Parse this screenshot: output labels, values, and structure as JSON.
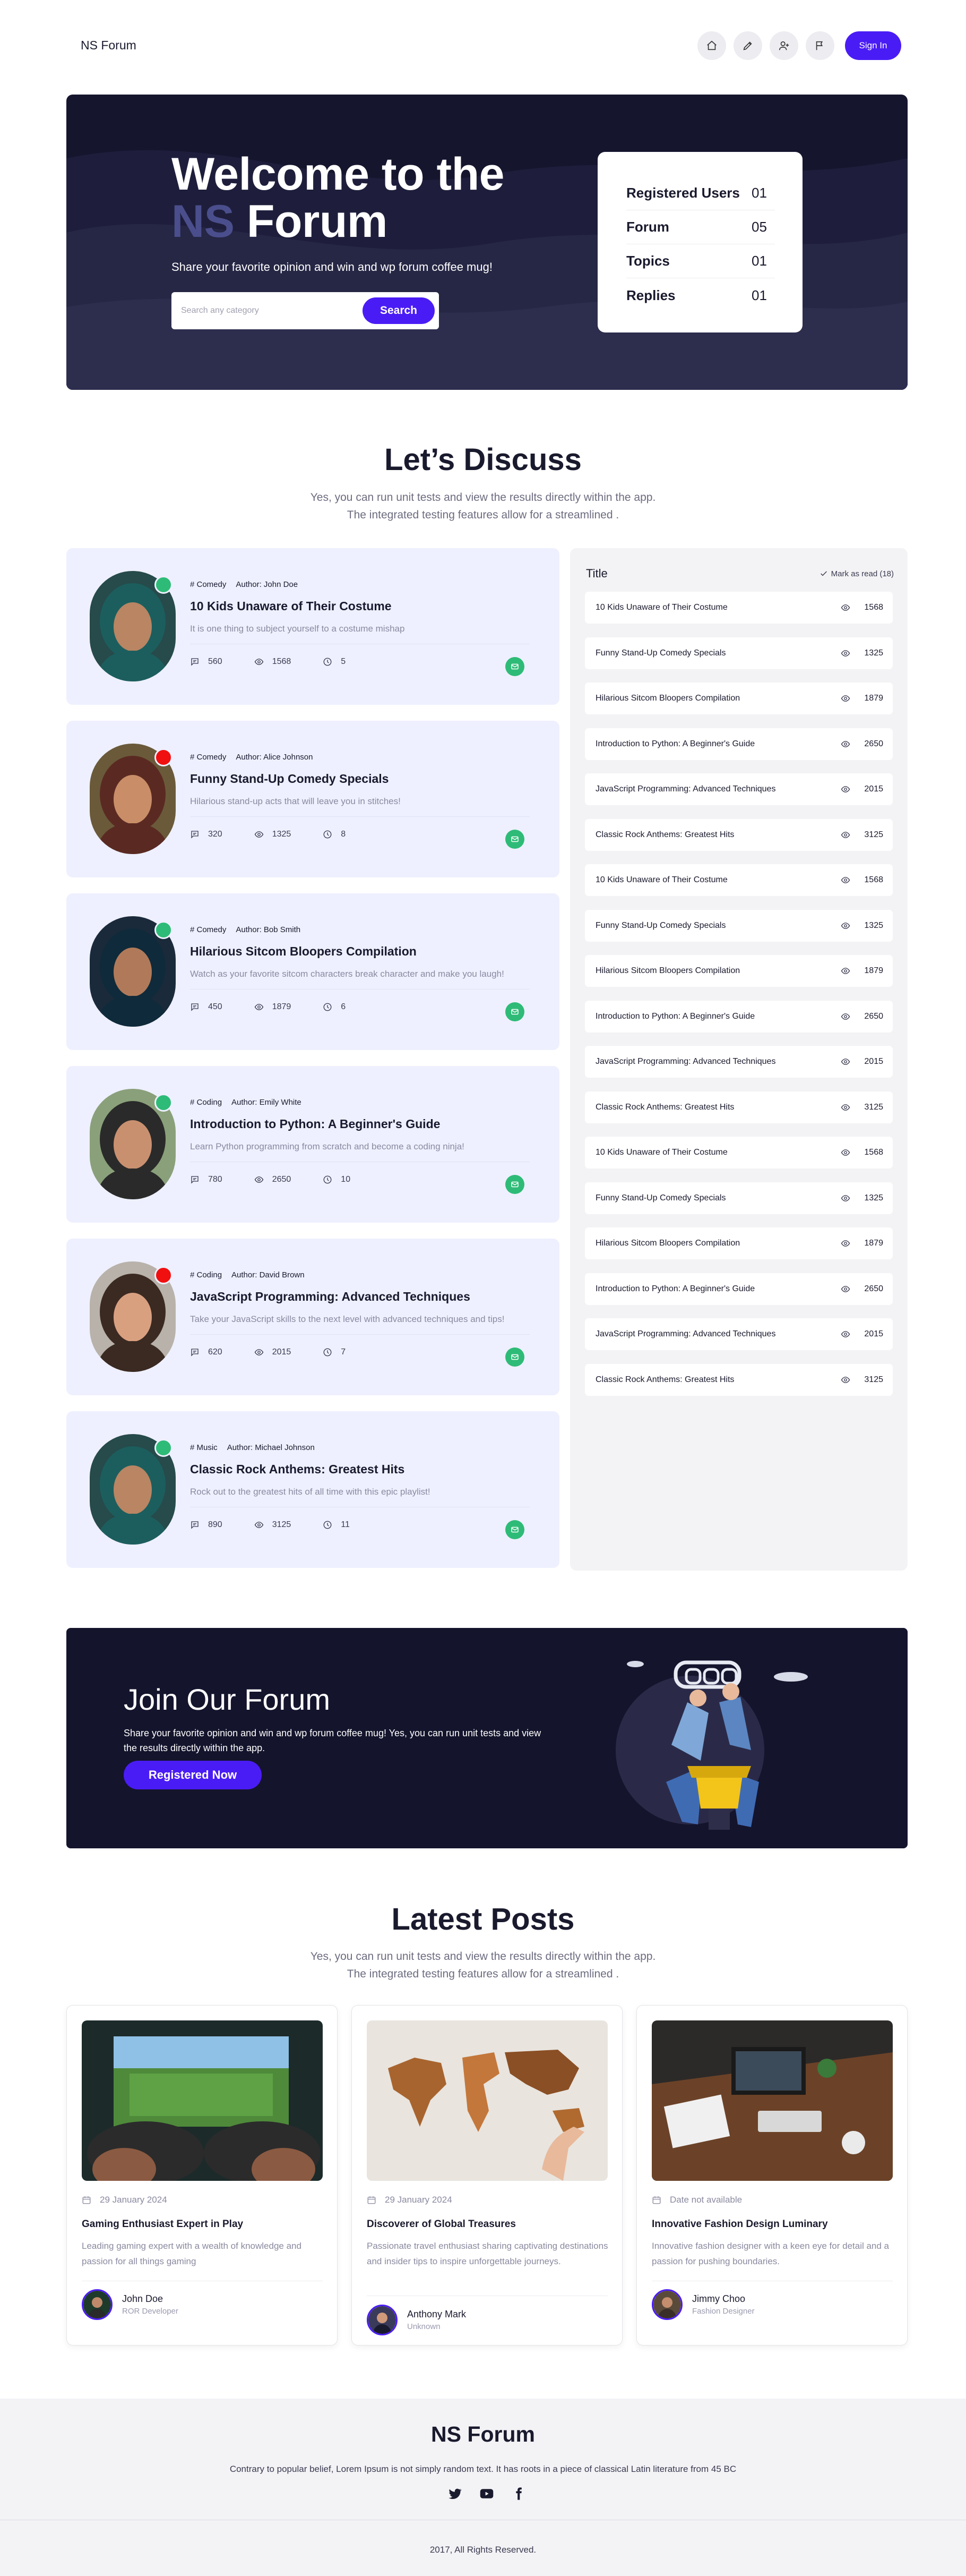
{
  "nav": {
    "brand": "NS Forum",
    "icons": [
      "home-icon",
      "pencil-icon",
      "user-plus-icon",
      "flag-icon"
    ],
    "signin_label": "Sign In"
  },
  "hero": {
    "title_line1": "Welcome to the",
    "title_ns": "NS",
    "title_rest": " Forum",
    "subtitle": "Share your favorite opinion and win and wp forum coffee mug!",
    "search_placeholder": "Search any category",
    "search_button": "Search",
    "stats": [
      {
        "label": "Registered Users",
        "value": "01"
      },
      {
        "label": "Forum",
        "value": "05"
      },
      {
        "label": "Topics",
        "value": "01"
      },
      {
        "label": "Replies",
        "value": "01"
      }
    ]
  },
  "discuss": {
    "heading": "Let’s Discuss",
    "text": "Yes, you can run unit tests and view the results directly within the app. The integrated testing features allow for a streamlined ."
  },
  "topics": [
    {
      "category": "# Comedy",
      "author": "Author: John Doe",
      "title": "10 Kids Unaware of Their Costume",
      "desc": "It is one thing to subject yourself to a costume mishap",
      "comments": "560",
      "views": "1568",
      "time": "5",
      "status_color": "#2ebb77"
    },
    {
      "category": "# Comedy",
      "author": "Author: Alice Johnson",
      "title": "Funny Stand-Up Comedy Specials",
      "desc": "Hilarious stand-up acts that will leave you in stitches!",
      "comments": "320",
      "views": "1325",
      "time": "8",
      "status_color": "#f01010"
    },
    {
      "category": "# Comedy",
      "author": "Author: Bob Smith",
      "title": "Hilarious Sitcom Bloopers Compilation",
      "desc": "Watch as your favorite sitcom characters break character and make you laugh!",
      "comments": "450",
      "views": "1879",
      "time": "6",
      "status_color": "#2ebb77"
    },
    {
      "category": "# Coding",
      "author": "Author: Emily White",
      "title": "Introduction to Python: A Beginner's Guide",
      "desc": "Learn Python programming from scratch and become a coding ninja!",
      "comments": "780",
      "views": "2650",
      "time": "10",
      "status_color": "#2ebb77"
    },
    {
      "category": "# Coding",
      "author": "Author: David Brown",
      "title": "JavaScript Programming: Advanced Techniques",
      "desc": "Take your JavaScript skills to the next level with advanced techniques and tips!",
      "comments": "620",
      "views": "2015",
      "time": "7",
      "status_color": "#f01010"
    },
    {
      "category": "# Music",
      "author": "Author: Michael Johnson",
      "title": "Classic Rock Anthems: Greatest Hits",
      "desc": "Rock out to the greatest hits of all time with this epic playlist!",
      "comments": "890",
      "views": "3125",
      "time": "11",
      "status_color": "#2ebb77"
    }
  ],
  "title_list": {
    "header": "Title",
    "mark_read": "Mark as read (18)",
    "items": [
      {
        "name": "10 Kids Unaware of Their Costume",
        "views": "1568"
      },
      {
        "name": "Funny Stand-Up Comedy Specials",
        "views": "1325"
      },
      {
        "name": "Hilarious Sitcom Bloopers Compilation",
        "views": "1879"
      },
      {
        "name": "Introduction to Python: A Beginner's Guide",
        "views": "2650"
      },
      {
        "name": "JavaScript Programming: Advanced Techniques",
        "views": "2015"
      },
      {
        "name": "Classic Rock Anthems: Greatest Hits",
        "views": "3125"
      },
      {
        "name": "10 Kids Unaware of Their Costume",
        "views": "1568"
      },
      {
        "name": "Funny Stand-Up Comedy Specials",
        "views": "1325"
      },
      {
        "name": "Hilarious Sitcom Bloopers Compilation",
        "views": "1879"
      },
      {
        "name": "Introduction to Python: A Beginner's Guide",
        "views": "2650"
      },
      {
        "name": "JavaScript Programming: Advanced Techniques",
        "views": "2015"
      },
      {
        "name": "Classic Rock Anthems: Greatest Hits",
        "views": "3125"
      },
      {
        "name": "10 Kids Unaware of Their Costume",
        "views": "1568"
      },
      {
        "name": "Funny Stand-Up Comedy Specials",
        "views": "1325"
      },
      {
        "name": "Hilarious Sitcom Bloopers Compilation",
        "views": "1879"
      },
      {
        "name": "Introduction to Python: A Beginner's Guide",
        "views": "2650"
      },
      {
        "name": "JavaScript Programming: Advanced Techniques",
        "views": "2015"
      },
      {
        "name": "Classic Rock Anthems: Greatest Hits",
        "views": "3125"
      }
    ]
  },
  "join": {
    "heading": "Join Our Forum",
    "text": "Share your favorite opinion and win and wp forum coffee mug! Yes, you can run unit tests and view the results directly within the app.",
    "button": "Registered Now"
  },
  "latest": {
    "heading": "Latest Posts",
    "text": "Yes, you can run unit tests and view the results directly within the app. The integrated testing features allow for a streamlined .",
    "posts": [
      {
        "date": "29 January 2024",
        "title": "Gaming Enthusiast Expert in Play",
        "desc": "Leading gaming expert with a wealth of knowledge and passion for all things gaming",
        "author": "John Doe",
        "role": "ROR Developer"
      },
      {
        "date": "29 January 2024",
        "title": "Discoverer of Global Treasures",
        "desc": "Passionate travel enthusiast sharing captivating destinations and insider tips to inspire unforgettable journeys.",
        "author": "Anthony Mark",
        "role": "Unknown"
      },
      {
        "date": "Date not available",
        "title": "Innovative Fashion Design Luminary",
        "desc": "Innovative fashion designer with a keen eye for detail and a passion for pushing boundaries.",
        "author": "Jimmy Choo",
        "role": "Fashion Designer"
      }
    ]
  },
  "footer": {
    "heading": "NS Forum",
    "text": "Contrary to popular belief, Lorem Ipsum is not simply random text. It has roots in a piece of classical Latin literature from 45 BC",
    "social": [
      "twitter-icon",
      "youtube-icon",
      "facebook-icon"
    ],
    "copyright": "2017, All Rights Reserved."
  },
  "colors": {
    "accent": "#4a1cf5",
    "dark": "#15152e",
    "success": "#2ebb77",
    "danger": "#f01010",
    "card_bg": "#eef0ff"
  }
}
